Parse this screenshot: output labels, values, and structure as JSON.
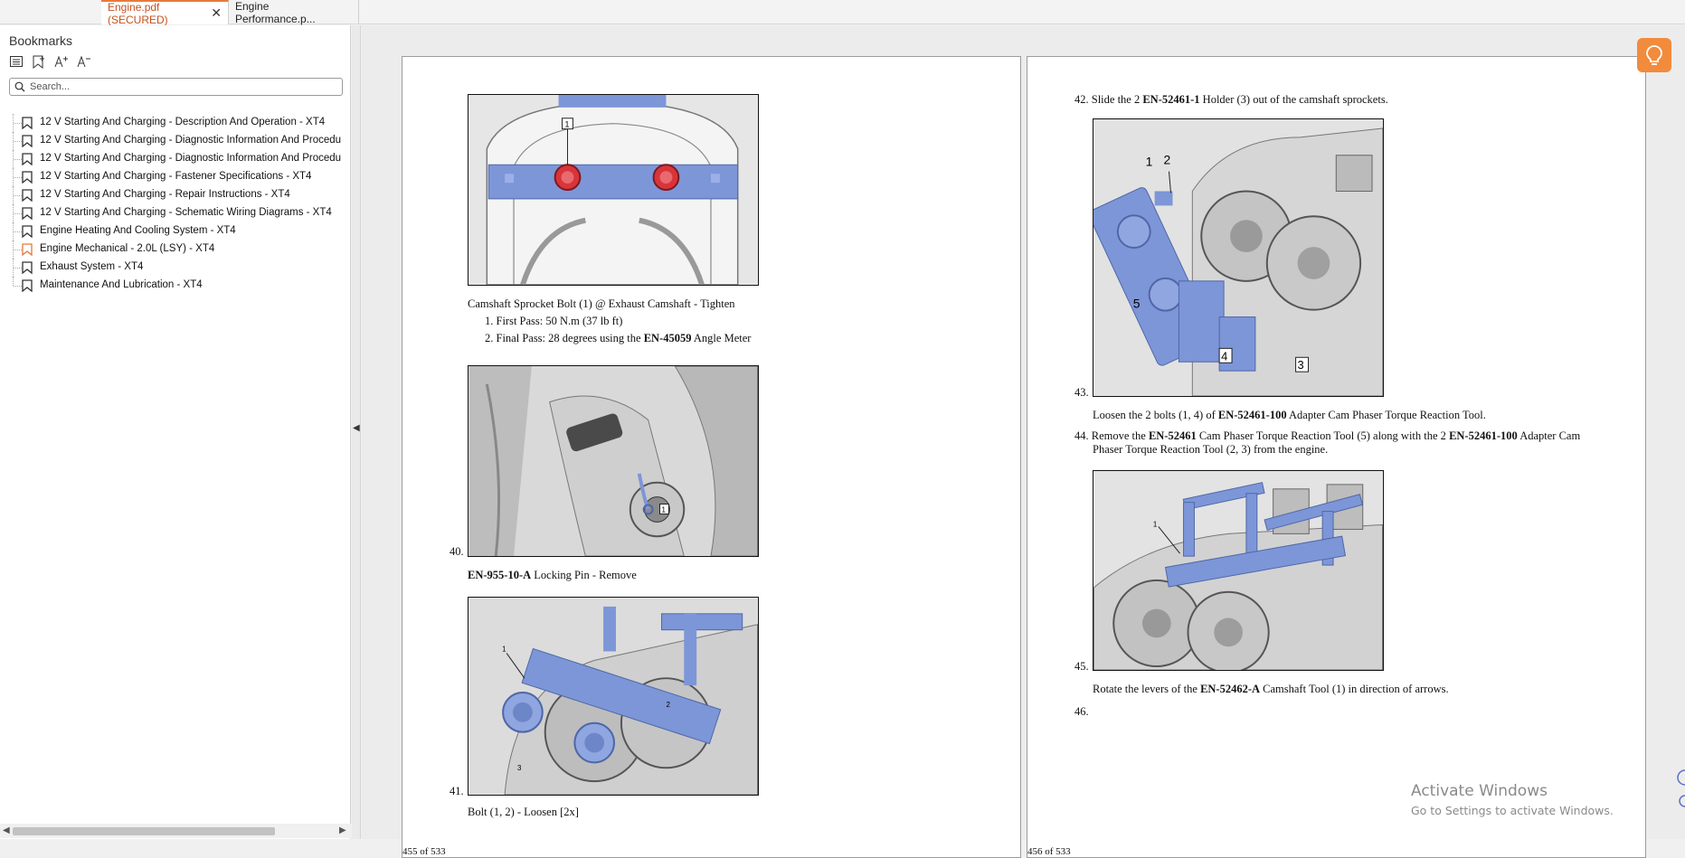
{
  "tabs": [
    {
      "label": "Engine.pdf (SECURED)",
      "active": true
    },
    {
      "label": "Engine Performance.p...",
      "active": false
    }
  ],
  "sidebar": {
    "title": "Bookmarks",
    "tools": [
      "list-view-icon",
      "bookmark-add-icon",
      "font-increase-icon",
      "font-decrease-icon"
    ],
    "search_placeholder": "Search...",
    "items": [
      {
        "label": "12 V Starting And Charging - Description And Operation - XT4",
        "highlight": false
      },
      {
        "label": "12 V Starting And Charging - Diagnostic Information And Procedu",
        "highlight": false
      },
      {
        "label": "12 V Starting And Charging - Diagnostic Information And Procedu",
        "highlight": false
      },
      {
        "label": "12 V Starting And Charging - Fastener Specifications - XT4",
        "highlight": false
      },
      {
        "label": "12 V Starting And Charging - Repair Instructions - XT4",
        "highlight": false
      },
      {
        "label": "12 V Starting And Charging - Schematic Wiring Diagrams - XT4",
        "highlight": false
      },
      {
        "label": "Engine Heating And Cooling System - XT4",
        "highlight": false
      },
      {
        "label": "Engine Mechanical - 2.0L (LSY) - XT4",
        "highlight": true
      },
      {
        "label": "Exhaust System - XT4",
        "highlight": false
      },
      {
        "label": "Maintenance And Lubrication - XT4",
        "highlight": false
      }
    ]
  },
  "page1": {
    "caption1": "Camshaft Sprocket Bolt (1) @ Exhaust Camshaft - Tighten",
    "list1": "1. First Pass: 50 N.m (37 lb ft)",
    "list2_pre": "2. Final Pass: 28 degrees using the ",
    "list2_bold": "EN-45059",
    "list2_post": " Angle Meter",
    "step40": "40.",
    "caption2_bold": "EN-955-10-A",
    "caption2_post": " Locking Pin - Remove",
    "step41": "41.",
    "caption3": "Bolt (1, 2) - Loosen [2x]",
    "footer": "455 of 533"
  },
  "page2": {
    "step42_pre": "42. Slide the 2 ",
    "step42_bold": "EN-52461-1",
    "step42_post": " Holder (3) out of the camshaft sprockets.",
    "step43": "43.",
    "text43_pre": "Loosen the 2 bolts (1, 4) of ",
    "text43_bold": "EN-52461-100",
    "text43_post": " Adapter Cam Phaser Torque Reaction Tool.",
    "step44_pre": "44. Remove the ",
    "step44_bold1": "EN-52461",
    "step44_mid": " Cam Phaser Torque Reaction Tool (5) along with the 2 ",
    "step44_bold2": "EN-52461-100",
    "step44_post": " Adapter Cam",
    "step44_line2": "Phaser Torque Reaction Tool (2, 3) from the engine.",
    "step45": "45.",
    "text45_pre": "Rotate the levers of the ",
    "text45_bold": "EN-52462-A",
    "text45_post": " Camshaft Tool (1) in direction of arrows.",
    "step46": "46.",
    "footer": "456 of 533"
  },
  "figure_labels": {
    "fig1": [
      "1"
    ],
    "fig2": [
      "1"
    ],
    "fig3": [
      "1",
      "2",
      "3"
    ],
    "fig4": [
      "1",
      "2",
      "5",
      "4",
      "3"
    ],
    "fig5": [
      "1"
    ]
  },
  "watermark": {
    "line1": "Activate Windows",
    "line2": "Go to Settings to activate Windows."
  },
  "colors": {
    "tool_blue": "#7d96d8",
    "accent_orange": "#e8793c",
    "bookmark_highlight": "#e07a3a"
  }
}
